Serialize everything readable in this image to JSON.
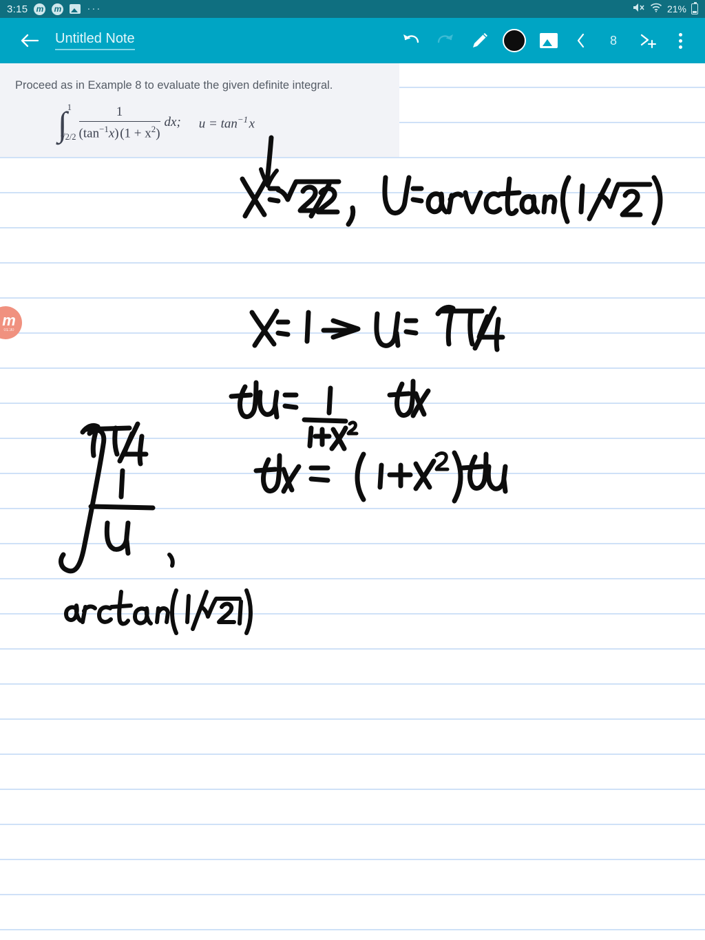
{
  "status_bar": {
    "clock": "3:15",
    "icons": [
      "m-badge-icon",
      "m-badge-icon",
      "image-icon",
      "overflow-dots-icon"
    ],
    "dots": "···",
    "mute_icon": "mute-icon",
    "wifi_icon": "wifi-icon",
    "battery_percent": "21%",
    "battery_icon": "battery-icon",
    "background": "#0f6f80"
  },
  "app_bar": {
    "back_label": "←",
    "title": "Untitled Note",
    "background": "#00a5c4",
    "tools": {
      "undo": "undo-icon",
      "redo": "redo-icon",
      "pen": "pencil-icon",
      "color": "color-swatch",
      "color_value": "#0d0d0d",
      "image": "image-icon",
      "prev_page": "‹",
      "page_number": "8",
      "add_page": "add-page-icon",
      "menu": "kebab-menu-icon"
    }
  },
  "problem": {
    "prompt": "Proceed as in Example 8 to evaluate the given definite integral.",
    "formula": {
      "upper_limit": "1",
      "lower_limit": "√2/2",
      "numerator": "1",
      "denominator_a": "tan",
      "denominator_a_exp": "−1",
      "denominator_a_var": "x",
      "denominator_b": "(1 + x",
      "denominator_b_exp": "2",
      "denominator_b_close": ")",
      "differential": "dx;",
      "substitution": "u = tan",
      "substitution_exp": "−1",
      "substitution_var": "x"
    }
  },
  "handwriting": {
    "line1": "x = √2/2 ,  u = arctan(1/√2)",
    "line2": "x = 1  =>  u = π/4",
    "line3": "du = 1/(1+x²) dx",
    "line4": "dx = (1+x²) du",
    "line5_integral_upper": "π/4",
    "line5_integral_lower": "arctan(1/√2)",
    "line5_integrand_num": "1",
    "line5_integrand_den": "u",
    "ink_color": "#0d0d0d"
  },
  "canvas": {
    "paper_color": "#ffffff",
    "rule_color": "#cfe1f7",
    "rule_spacing": 51,
    "problem_block_color": "#f2f3f7"
  },
  "watermark": {
    "letter": "m",
    "caption": "01:30",
    "color": "#f0917f"
  }
}
